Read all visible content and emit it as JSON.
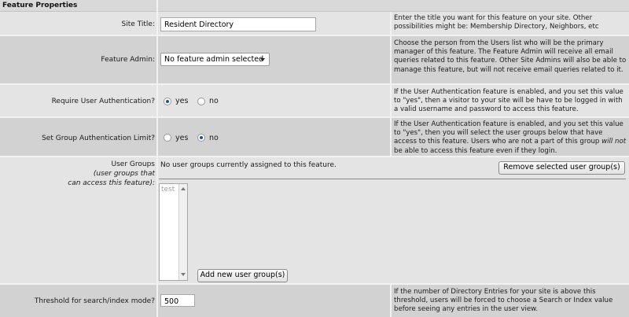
{
  "header": {
    "title": "Feature Properties"
  },
  "site_title": {
    "label": "Site Title:",
    "value": "Resident Directory",
    "help": "Enter the title you want for this feature on your site. Other possibilities might be: Membership Directory, Neighbors, etc"
  },
  "feature_admin": {
    "label": "Feature Admin:",
    "selected": "No feature admin selected",
    "help": "Choose the person from the Users list who will be the primary manager of this feature. The Feature Admin will receive all email queries related to this feature. Other Site Admins will also be able to manage this feature, but will not receive email queries related to it."
  },
  "require_auth": {
    "label": "Require User Authentication?",
    "yes_label": "yes",
    "no_label": "no",
    "selected": "yes",
    "help": "If the User Authentication feature is enabled, and you set this value to \"yes\", then a visitor to your site will be have to be logged in with a valid username and password to access this feature."
  },
  "group_auth": {
    "label": "Set Group Authentication Limit?",
    "yes_label": "yes",
    "no_label": "no",
    "selected": "no",
    "help_part1": "If the User Authentication feature is enabled, and you set this value to \"yes\", then you will select the user groups below that have access to this feature. Users who are not a part of this group ",
    "help_italic": "will not",
    "help_part2": " be able to access this feature even if they login."
  },
  "user_groups": {
    "label_line1": "User Groups",
    "label_line2": "(user groups that",
    "label_line3": "can access this feature):",
    "none_assigned": "No user groups currently assigned to this feature.",
    "remove_button": "Remove selected user group(s)",
    "available": [
      "test"
    ],
    "add_button": "Add new user group(s)"
  },
  "threshold": {
    "label": "Threshold for search/index mode?",
    "value": "500",
    "help": "If the number of Directory Entries for your site is above this threshold, users will be forced to choose a Search or Index value before seeing any entries in the user view."
  }
}
